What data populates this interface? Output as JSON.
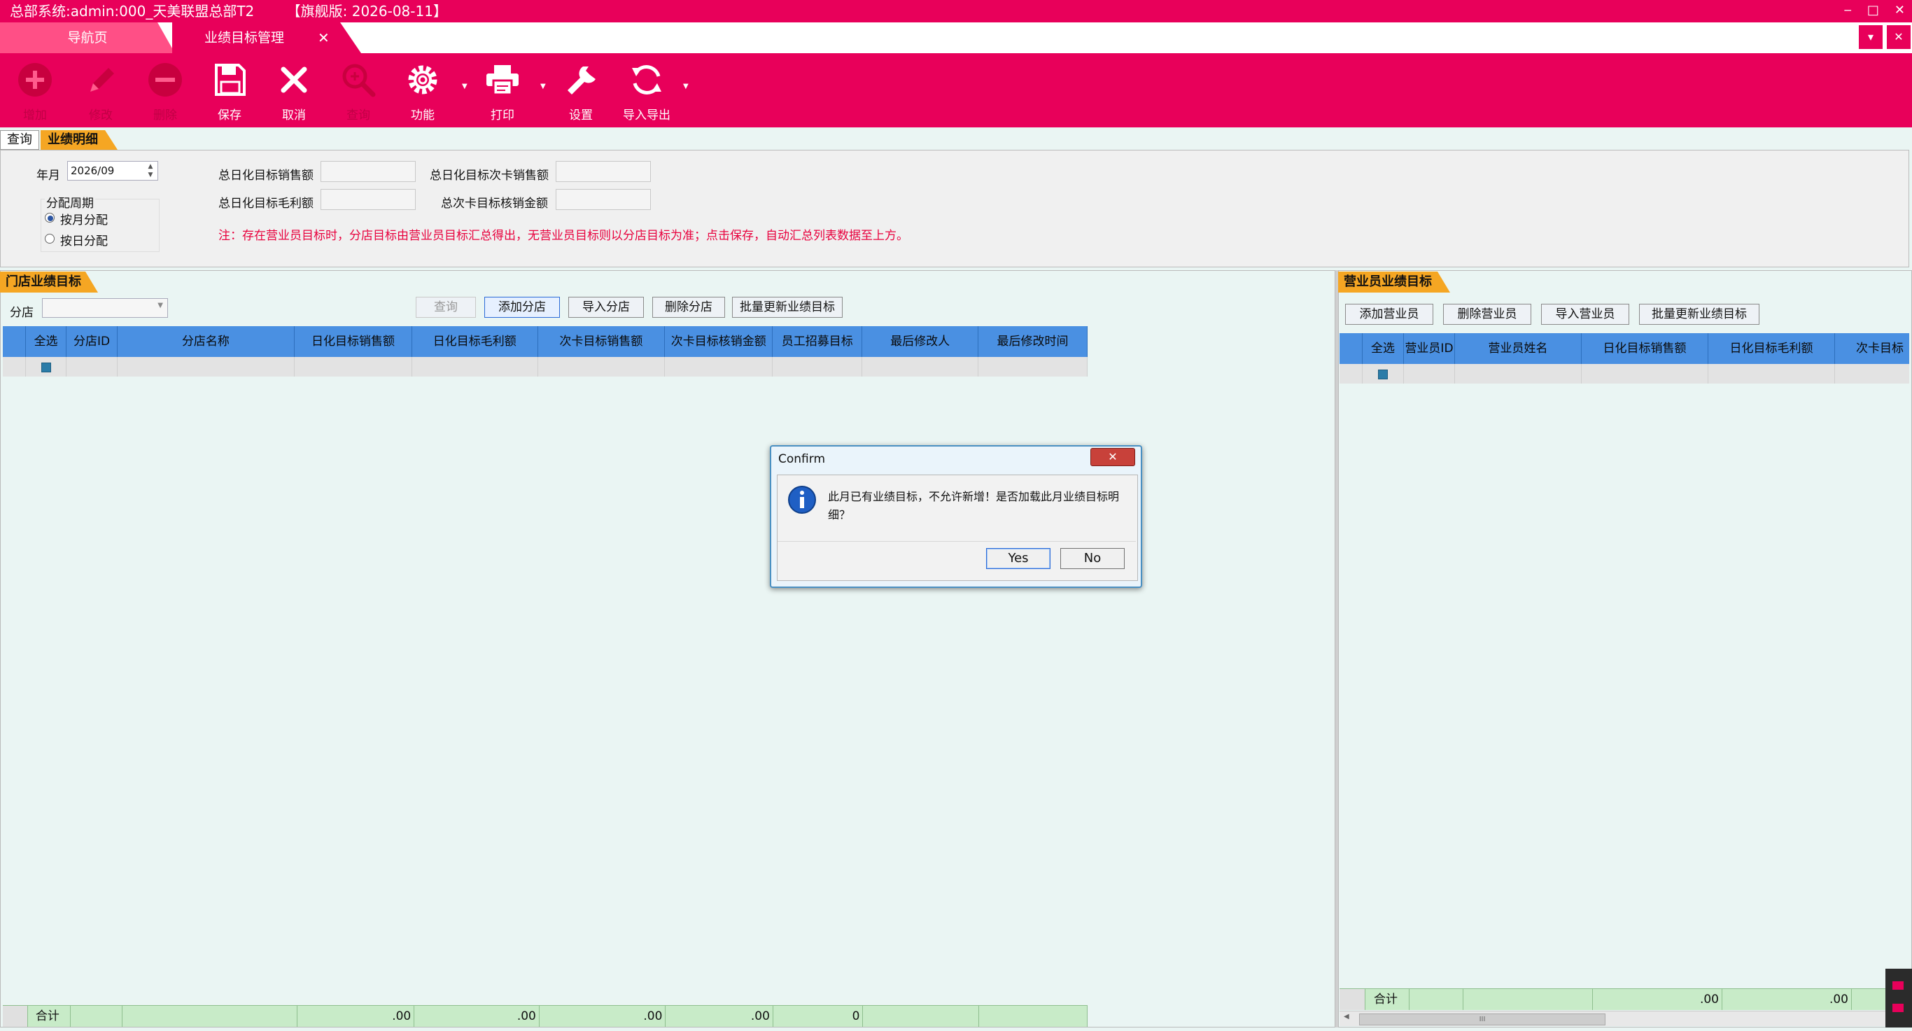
{
  "titlebar": {
    "title": "总部系统:admin:000_天美联盟总部T2",
    "version": "【旗舰版: 2026-08-11】",
    "buttons": [
      "‒",
      "□",
      "✕"
    ]
  },
  "tabs": [
    {
      "label": "导航页"
    },
    {
      "label": "业绩目标管理",
      "close": "✕"
    }
  ],
  "tab_controls": [
    "▾",
    "✕"
  ],
  "toolbar": [
    {
      "label": "增加",
      "icon": "add-icon"
    },
    {
      "label": "修改",
      "icon": "edit-icon"
    },
    {
      "label": "删除",
      "icon": "delete-icon"
    },
    {
      "label": "保存",
      "icon": "save-icon"
    },
    {
      "label": "取消",
      "icon": "cancel-icon"
    },
    {
      "label": "查询",
      "icon": "search-icon"
    },
    {
      "label": "功能",
      "icon": "gear-icon"
    },
    {
      "label": "打印",
      "icon": "printer-icon"
    },
    {
      "label": "设置",
      "icon": "wrench-icon"
    },
    {
      "label": "导入导出",
      "icon": "refresh-icon"
    }
  ],
  "subtabs": [
    {
      "label": "查询"
    },
    {
      "label": "业绩明细"
    }
  ],
  "query": {
    "year_month_label": "年月",
    "year_month_value": "2026/09",
    "period_label": "分配周期",
    "period_options": [
      {
        "label": "按月分配",
        "checked": true
      },
      {
        "label": "按日分配",
        "checked": false
      }
    ],
    "fields": [
      {
        "label": "总日化目标销售额",
        "value": ""
      },
      {
        "label": "总日化目标次卡销售额",
        "value": ""
      },
      {
        "label": "总日化目标毛利额",
        "value": ""
      },
      {
        "label": "总次卡目标核销金额",
        "value": ""
      }
    ],
    "note": "注：存在营业员目标时，分店目标由营业员目标汇总得出，无营业员目标则以分店目标为准；点击保存，自动汇总列表数据至上方。"
  },
  "store_panel": {
    "title": "门店业绩目标",
    "branch_label": "分店",
    "buttons": [
      "查询",
      "添加分店",
      "导入分店",
      "删除分店",
      "批量更新业绩目标"
    ],
    "columns": [
      "全选",
      "分店ID",
      "分店名称",
      "日化目标销售额",
      "日化目标毛利额",
      "次卡目标销售额",
      "次卡目标核销金额",
      "员工招募目标",
      "最后修改人",
      "最后修改时间"
    ],
    "sum_label": "合计",
    "sums": [
      "",
      "",
      "",
      ".00",
      ".00",
      ".00",
      ".00",
      "0",
      "",
      ""
    ]
  },
  "staff_panel": {
    "title": "营业员业绩目标",
    "buttons": [
      "添加营业员",
      "删除营业员",
      "导入营业员",
      "批量更新业绩目标"
    ],
    "columns": [
      "全选",
      "营业员ID",
      "营业员姓名",
      "日化目标销售额",
      "日化目标毛利额",
      "次卡目标"
    ],
    "sum_label": "合计",
    "sums": [
      "",
      "",
      "",
      ".00",
      ".00",
      ""
    ],
    "scroll_grip": "III"
  },
  "dialog": {
    "title": "Confirm",
    "message": "此月已有业绩目标，不允许新增！是否加载此月业绩目标明细？",
    "yes": "Yes",
    "no": "No",
    "close": "✕"
  },
  "colors": {
    "brand": "#e8005a",
    "tab_orange": "#f5a623",
    "grid_header": "#4a90e2",
    "sum_row": "#c8ebc8"
  }
}
